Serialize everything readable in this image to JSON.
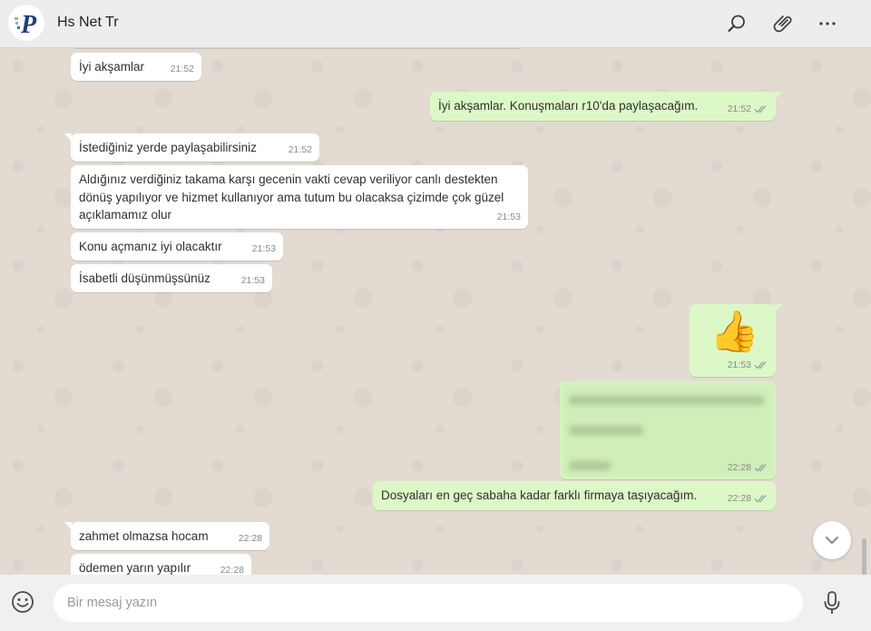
{
  "header": {
    "contact_name": "Hs Net Tr",
    "avatar_letter": "P"
  },
  "icons": {
    "search": "search-icon",
    "attach": "paperclip-icon",
    "menu": "more-options-icon",
    "emoji": "emoji-icon",
    "mic": "microphone-icon",
    "scroll": "chevron-down-icon"
  },
  "colors": {
    "incoming": "#ffffff",
    "outgoing": "#dcf8c6",
    "tick": "#8ea4a0"
  },
  "messages": [
    {
      "dir": "in",
      "text": "İyi akşamlar",
      "time": "21:52"
    },
    {
      "dir": "out",
      "text": "İyi akşamlar. Konuşmaları r10'da paylaşacağım.",
      "time": "21:52"
    },
    {
      "dir": "in",
      "text": "İstediğiniz yerde paylaşabilirsiniz",
      "time": "21:52"
    },
    {
      "dir": "in",
      "text": "Aldığınız verdiğiniz takama karşı gecenin vakti cevap veriliyor canlı destekten dönüş yapılıyor ve hizmet kullanıyor ama tutum bu olacaksa çizimde çok güzel açıklamamız olur",
      "time": "21:53"
    },
    {
      "dir": "in",
      "text": "Konu açmanız iyi olacaktır",
      "time": "21:53"
    },
    {
      "dir": "in",
      "text": "İsabetli düşünmüşsünüz",
      "time": "21:53"
    },
    {
      "dir": "out",
      "text": "👍",
      "time": "21:53"
    },
    {
      "dir": "out",
      "text": "",
      "time": "22:28"
    },
    {
      "dir": "out",
      "text": "Dosyaları en geç sabaha kadar farklı firmaya taşıyacağım.",
      "time": "22:28"
    },
    {
      "dir": "in",
      "text": "zahmet olmazsa hocam",
      "time": "22:28"
    },
    {
      "dir": "in",
      "text": "ödemen yarın yapılır",
      "time": "22:28"
    }
  ],
  "composer": {
    "placeholder": "Bir mesaj yazın"
  }
}
